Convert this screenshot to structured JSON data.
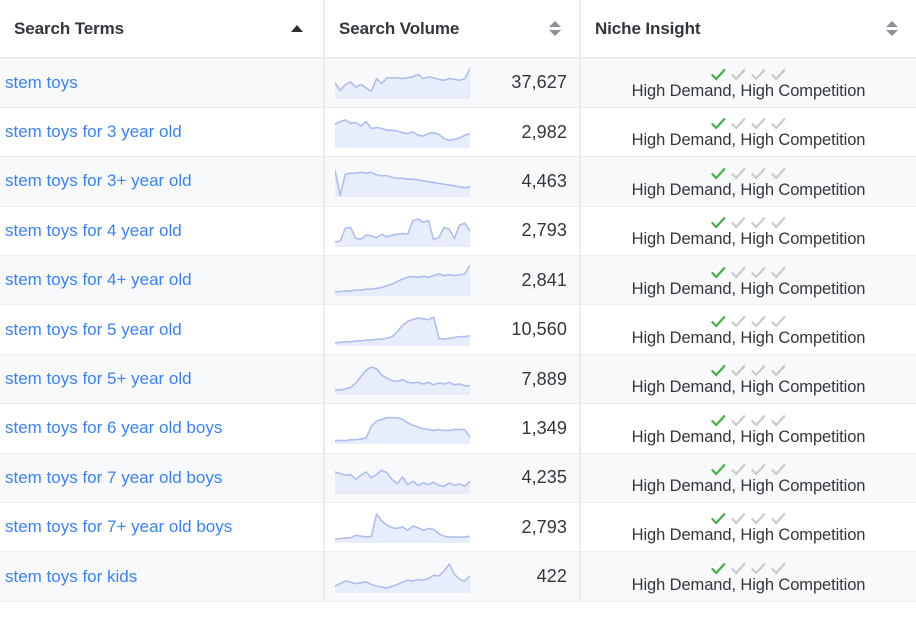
{
  "colors": {
    "link": "#3b82f6",
    "header_text": "#32373c",
    "row_stripe": "#f8f9fa",
    "row_plain": "#ffffff",
    "border": "#e9ecef",
    "spark_line": "#aebef0",
    "spark_fill": "#e8edfb",
    "check_active": "#4caf50",
    "check_inactive": "#cccccc"
  },
  "table": {
    "columns": [
      {
        "key": "search_terms",
        "label": "Search Terms",
        "sort_icon": "sort-ascending-icon",
        "sort_state": "asc",
        "align": "left"
      },
      {
        "key": "search_volume",
        "label": "Search Volume",
        "sort_icon": "sort-both-icon",
        "sort_state": "none",
        "align": "right"
      },
      {
        "key": "niche_insight",
        "label": "Niche Insight",
        "sort_icon": "sort-both-icon",
        "sort_state": "none",
        "align": "center"
      }
    ],
    "rows": [
      {
        "term": "stem toys",
        "volume": "37,627",
        "niche": "High Demand, High Competition",
        "checks_total": 4,
        "checks_active": 1,
        "trend": [
          38,
          20,
          34,
          40,
          28,
          34,
          26,
          18,
          48,
          36,
          50,
          50,
          50,
          48,
          50,
          52,
          58,
          48,
          52,
          50,
          46,
          44,
          48,
          46,
          44,
          48,
          72
        ]
      },
      {
        "term": "stem toys for 3 year old",
        "volume": "2,982",
        "niche": "High Demand, High Competition",
        "checks_total": 4,
        "checks_active": 1,
        "trend": [
          56,
          62,
          66,
          58,
          60,
          52,
          62,
          46,
          48,
          46,
          42,
          42,
          40,
          36,
          34,
          38,
          30,
          28,
          34,
          36,
          32,
          22,
          18,
          20,
          24,
          30,
          34
        ]
      },
      {
        "term": "stem toys for 3+ year old",
        "volume": "4,463",
        "niche": "High Demand, High Competition",
        "checks_total": 4,
        "checks_active": 1,
        "trend": [
          62,
          4,
          54,
          56,
          56,
          58,
          56,
          58,
          52,
          50,
          50,
          46,
          44,
          44,
          42,
          42,
          40,
          38,
          36,
          34,
          32,
          30,
          28,
          26,
          24,
          22,
          24
        ]
      },
      {
        "term": "stem toys for 4 year old",
        "volume": "2,793",
        "niche": "High Demand, High Competition",
        "checks_total": 4,
        "checks_active": 1,
        "trend": [
          12,
          14,
          44,
          46,
          20,
          18,
          28,
          26,
          22,
          30,
          24,
          28,
          30,
          32,
          30,
          62,
          66,
          58,
          62,
          18,
          22,
          46,
          42,
          20,
          52,
          56,
          38
        ]
      },
      {
        "term": "stem toys for 4+ year old",
        "volume": "2,841",
        "niche": "High Demand, High Competition",
        "checks_total": 4,
        "checks_active": 1,
        "trend": [
          10,
          10,
          12,
          12,
          14,
          14,
          16,
          16,
          18,
          20,
          24,
          28,
          34,
          40,
          44,
          46,
          44,
          46,
          44,
          48,
          52,
          48,
          50,
          48,
          50,
          52,
          72
        ]
      },
      {
        "term": "stem toys for 5 year old",
        "volume": "10,560",
        "niche": "High Demand, High Competition",
        "checks_total": 4,
        "checks_active": 1,
        "trend": [
          8,
          8,
          10,
          10,
          12,
          12,
          14,
          14,
          16,
          16,
          18,
          22,
          34,
          48,
          58,
          62,
          66,
          64,
          62,
          68,
          18,
          16,
          18,
          20,
          22,
          22,
          24
        ]
      },
      {
        "term": "stem toys for 5+ year old",
        "volume": "7,889",
        "niche": "High Demand, High Competition",
        "checks_total": 4,
        "checks_active": 1,
        "trend": [
          12,
          12,
          14,
          18,
          28,
          44,
          58,
          66,
          62,
          46,
          40,
          34,
          32,
          36,
          30,
          28,
          30,
          26,
          30,
          24,
          28,
          26,
          30,
          24,
          26,
          22,
          22
        ]
      },
      {
        "term": "stem toys for 6 year old boys",
        "volume": "1,349",
        "niche": "High Demand, High Competition",
        "checks_total": 4,
        "checks_active": 1,
        "trend": [
          8,
          8,
          8,
          10,
          10,
          12,
          14,
          42,
          54,
          58,
          62,
          62,
          62,
          58,
          50,
          44,
          40,
          36,
          34,
          32,
          34,
          32,
          32,
          34,
          34,
          34,
          16
        ]
      },
      {
        "term": "stem toys for 7 year old boys",
        "volume": "4,235",
        "niche": "High Demand, High Competition",
        "checks_total": 4,
        "checks_active": 1,
        "trend": [
          52,
          48,
          44,
          46,
          34,
          44,
          52,
          38,
          46,
          56,
          50,
          34,
          24,
          40,
          22,
          30,
          20,
          26,
          22,
          28,
          20,
          18,
          26,
          20,
          24,
          18,
          30
        ]
      },
      {
        "term": "stem toys for 7+ year old boys",
        "volume": "2,793",
        "niche": "High Demand, High Competition",
        "checks_total": 4,
        "checks_active": 1,
        "trend": [
          10,
          10,
          12,
          12,
          18,
          16,
          14,
          16,
          68,
          52,
          42,
          36,
          34,
          38,
          30,
          40,
          36,
          30,
          34,
          32,
          22,
          16,
          14,
          14,
          14,
          14,
          16
        ]
      },
      {
        "term": "stem toys for kids",
        "volume": "422",
        "niche": "High Demand, High Competition",
        "checks_total": 4,
        "checks_active": 1,
        "trend": [
          16,
          22,
          28,
          26,
          22,
          24,
          26,
          20,
          16,
          14,
          12,
          16,
          20,
          26,
          30,
          28,
          32,
          30,
          34,
          42,
          40,
          52,
          68,
          44,
          32,
          28,
          40
        ]
      }
    ]
  }
}
